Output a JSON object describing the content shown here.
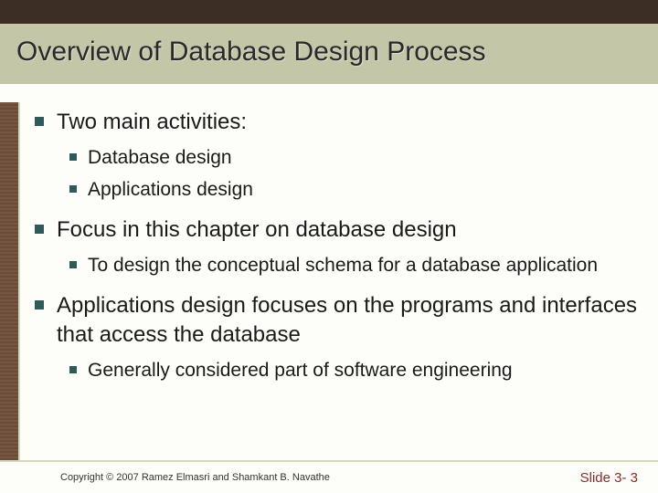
{
  "title": "Overview of Database Design Process",
  "bullets": [
    {
      "text": "Two main activities:",
      "children": [
        {
          "text": "Database design"
        },
        {
          "text": "Applications design"
        }
      ]
    },
    {
      "text": "Focus in this chapter on database design",
      "children": [
        {
          "text": "To design the conceptual schema for a database application"
        }
      ]
    },
    {
      "text": "Applications design focuses on the programs and interfaces that access the database",
      "children": [
        {
          "text": "Generally considered part of software engineering"
        }
      ]
    }
  ],
  "footer": {
    "copyright": "Copyright © 2007 Ramez Elmasri and Shamkant B. Navathe",
    "slide_label": "Slide 3- 3"
  }
}
